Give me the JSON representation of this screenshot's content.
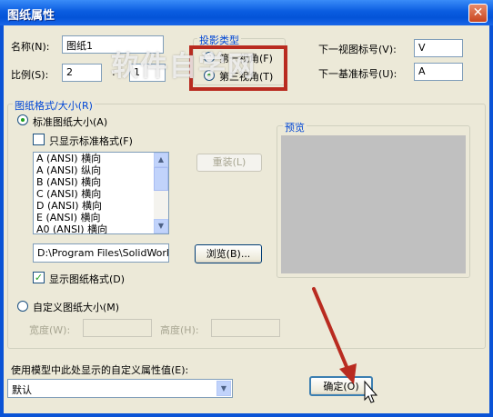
{
  "window": {
    "title": "图纸属性",
    "close_glyph": "✕"
  },
  "fields": {
    "name_label": "名称(N):",
    "name_value": "图纸1",
    "scale_label": "比例(S):",
    "scale_num": "2",
    "scale_sep": ":",
    "scale_den": "1"
  },
  "projection": {
    "title": "投影类型",
    "first_angle": "第一视角(F)",
    "third_angle": "第三视角(T)"
  },
  "labels": {
    "next_view_label": "下一视图标号(V):",
    "next_view_value": "V",
    "next_datum_label": "下一基准标号(U):",
    "next_datum_value": "A"
  },
  "sheet_format": {
    "title": "图纸格式/大小(R)",
    "standard_label": "标准图纸大小(A)",
    "only_standard_label": "只显示标准格式(F)",
    "sizes": [
      "A (ANSI) 横向",
      "A (ANSI) 纵向",
      "B (ANSI) 横向",
      "C (ANSI) 横向",
      "D (ANSI) 横向",
      "E (ANSI) 横向",
      "A0 (ANSI) 横向"
    ],
    "reload_label": "重装(L)",
    "path_value": "D:\\Program Files\\SolidWorks\\d",
    "browse_label": "浏览(B)...",
    "display_format_label": "显示图纸格式(D)",
    "custom_label": "自定义图纸大小(M)",
    "width_label": "宽度(W):",
    "height_label": "高度(H):",
    "preview_label": "预览"
  },
  "bottom": {
    "custom_prop_label": "使用模型中此处显示的自定义属性值(E):",
    "combo_value": "默认",
    "ok_label": "确定(O)"
  },
  "watermark": {
    "text": "软件自学网"
  },
  "colors": {
    "title_bar": "#0a5ce0",
    "dialog_bg": "#ece9d8",
    "accent": "#0046d5",
    "annotation": "#b92b20",
    "preview_bg": "#c0c0c0"
  }
}
